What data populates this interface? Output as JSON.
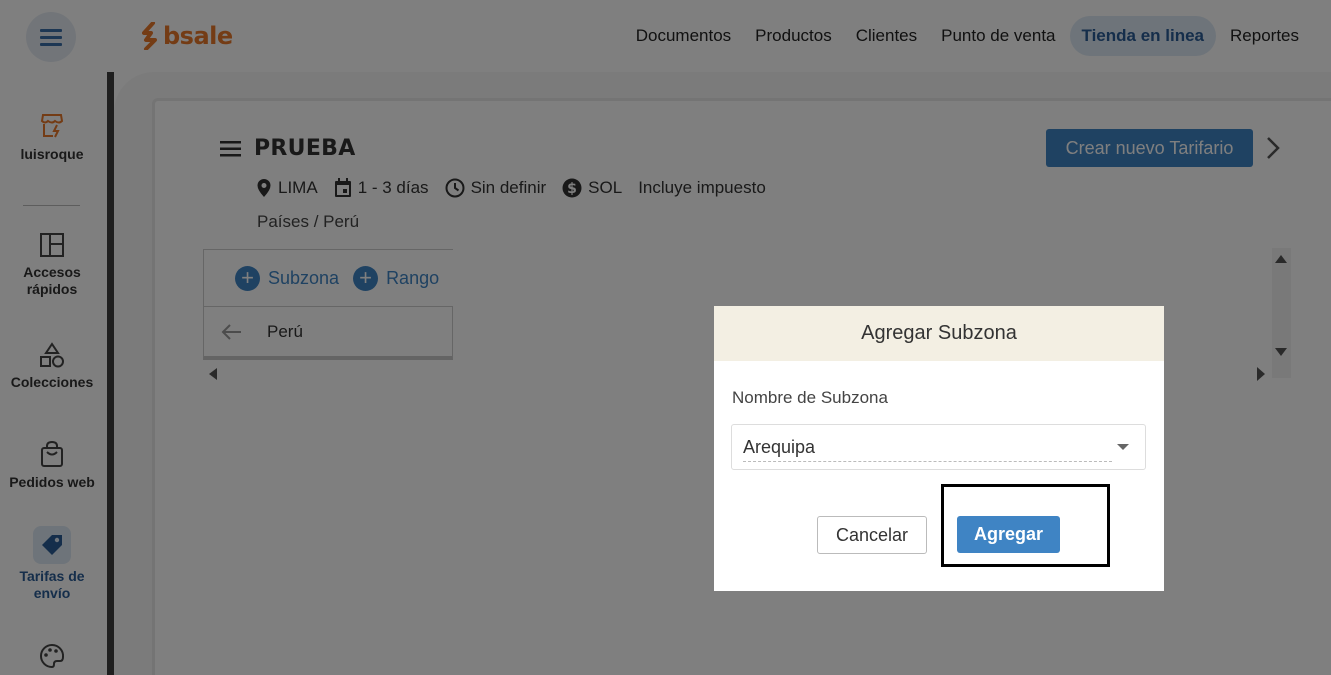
{
  "header": {
    "logo_text": "bsale",
    "nav": [
      {
        "label": "Documentos",
        "active": false
      },
      {
        "label": "Productos",
        "active": false
      },
      {
        "label": "Clientes",
        "active": false
      },
      {
        "label": "Punto de venta",
        "active": false
      },
      {
        "label": "Tienda en linea",
        "active": true
      },
      {
        "label": "Reportes",
        "active": false
      }
    ]
  },
  "sidebar": {
    "store_name": "luisroque",
    "items": [
      {
        "label": "Accesos rápidos",
        "icon": "layout-icon"
      },
      {
        "label": "Colecciones",
        "icon": "shapes-icon"
      },
      {
        "label": "Pedidos web",
        "icon": "shopping-bag-icon"
      },
      {
        "label": "Tarifas de envío",
        "icon": "tag-icon",
        "active": true
      },
      {
        "label": "",
        "icon": "palette-icon"
      }
    ]
  },
  "main": {
    "title": "PRUEBA",
    "meta": {
      "location": "LIMA",
      "delivery": "1 - 3 días",
      "schedule": "Sin definir",
      "currency": "SOL",
      "tax": "Incluye impuesto"
    },
    "breadcrumb": "Países / Perú",
    "create_button": "Crear nuevo Tarifario",
    "tree": {
      "add_subzone": "Subzona",
      "add_range": "Rango",
      "current_zone": "Perú"
    }
  },
  "modal": {
    "title": "Agregar Subzona",
    "field_label": "Nombre de Subzona",
    "field_value": "Arequipa",
    "cancel_label": "Cancelar",
    "submit_label": "Agregar"
  },
  "colors": {
    "brand": "#e8792b",
    "primary": "#3f84c4",
    "active_nav_bg": "#dde8f4",
    "modal_header_bg": "#f3efe3"
  }
}
